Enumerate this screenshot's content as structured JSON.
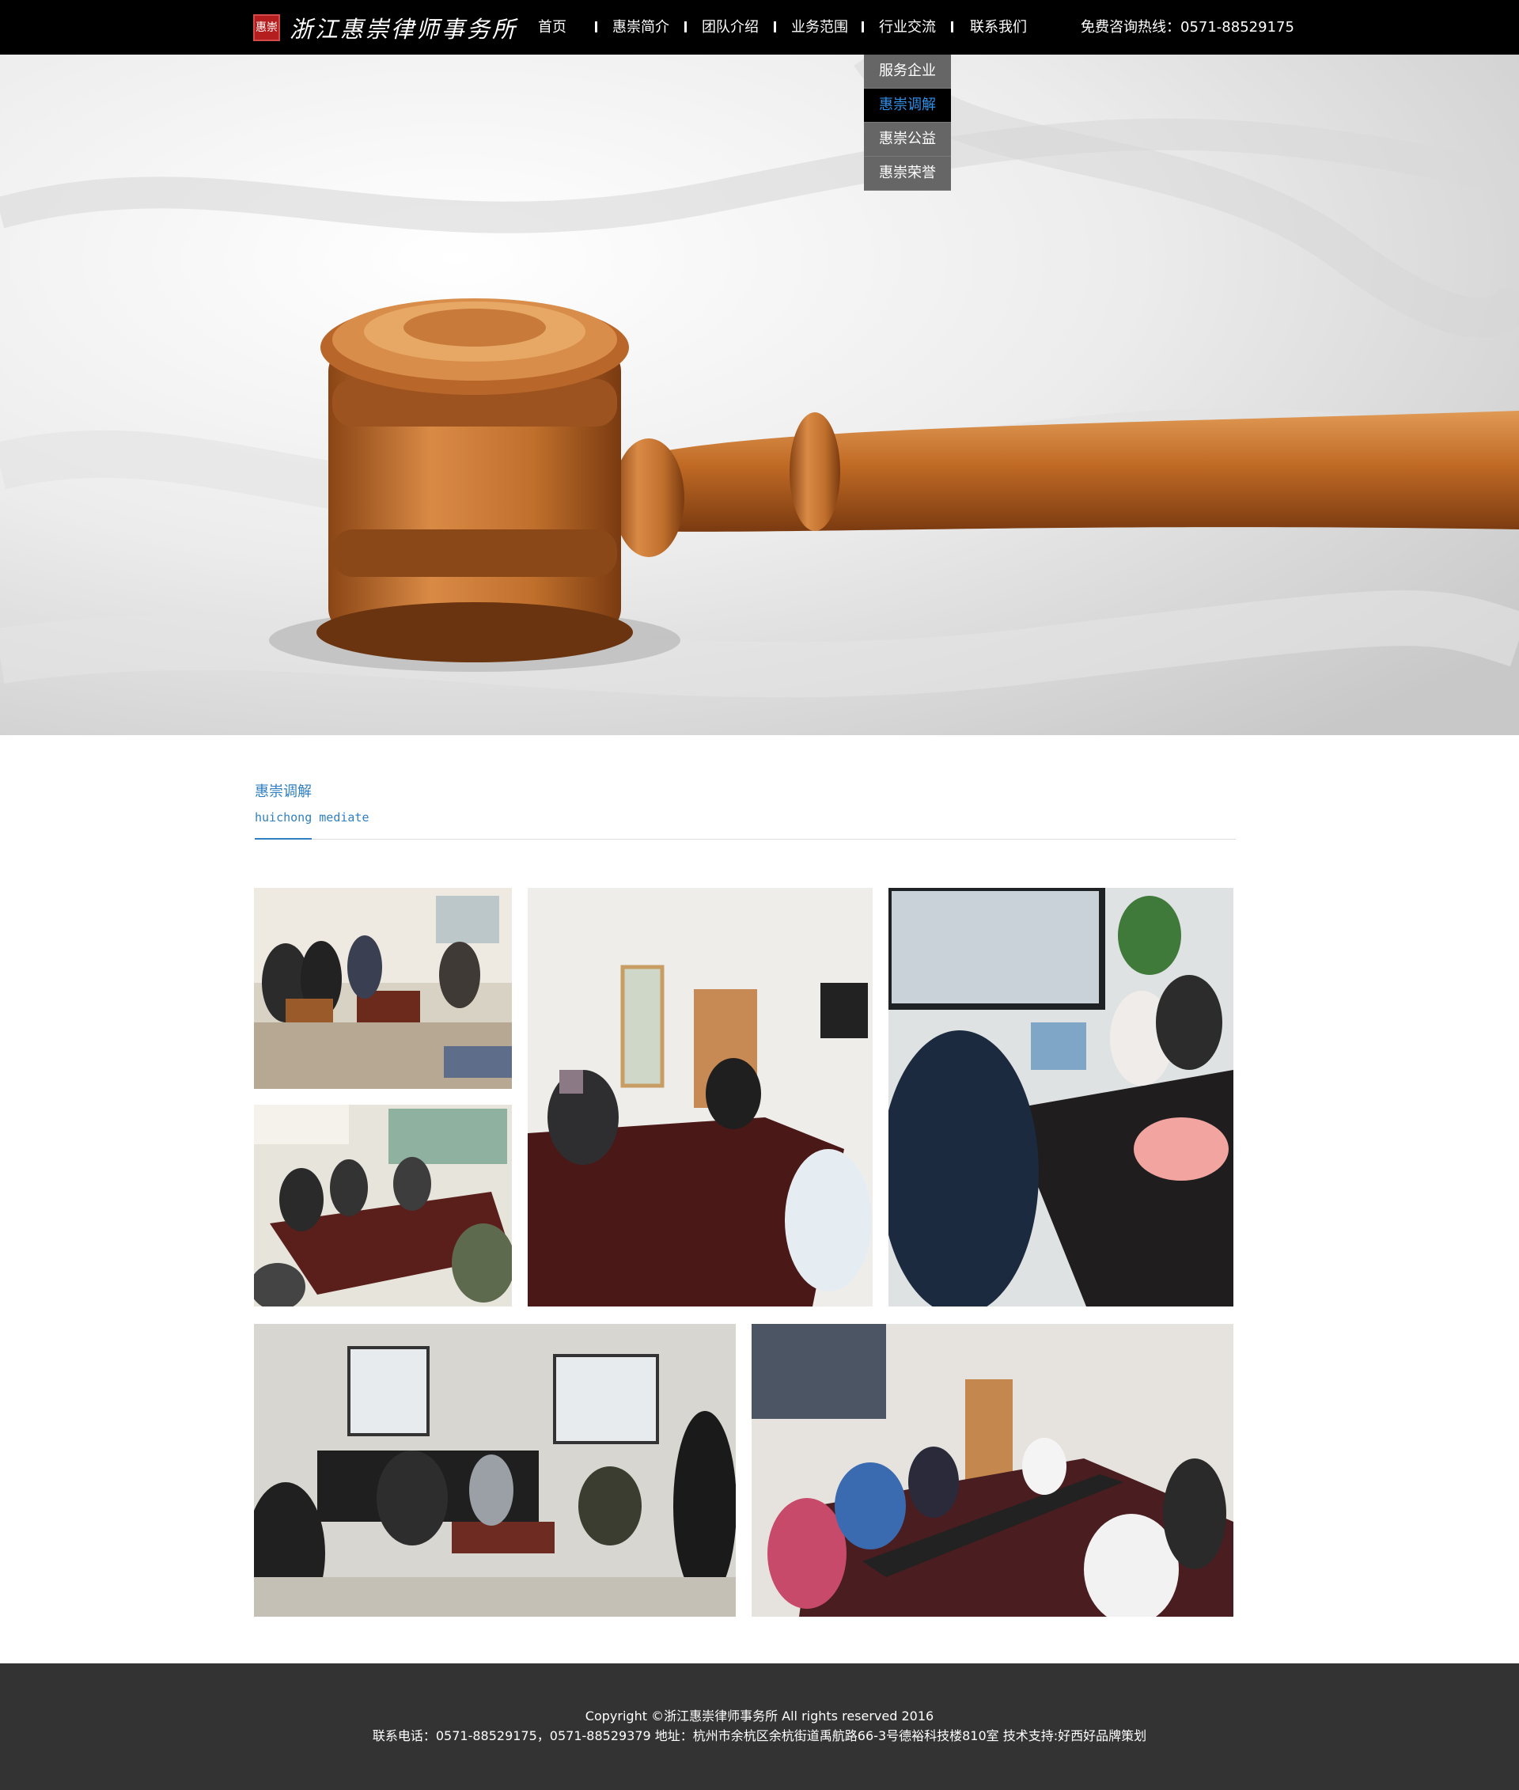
{
  "header": {
    "logo_seal": "惠崇",
    "logo_text": "浙江惠崇律师事务所",
    "hotline": "免费咨询热线：0571-88529175"
  },
  "nav": {
    "items": [
      {
        "label": "首页"
      },
      {
        "label": "惠崇简介"
      },
      {
        "label": "团队介绍"
      },
      {
        "label": "业务范围"
      },
      {
        "label": "行业交流"
      },
      {
        "label": "联系我们"
      }
    ],
    "dropdown": [
      {
        "label": "服务企业",
        "active": false
      },
      {
        "label": "惠崇调解",
        "active": true
      },
      {
        "label": "惠崇公益",
        "active": false
      },
      {
        "label": "惠崇荣誉",
        "active": false
      }
    ]
  },
  "hero": {
    "image": "wooden-gavel-on-white-cloth"
  },
  "section": {
    "title": "惠崇调解",
    "subtitle": "huichong mediate"
  },
  "gallery": {
    "photos": [
      {
        "subject": "mediation-meeting-sofas"
      },
      {
        "subject": "mediation-meeting-conference-table"
      },
      {
        "subject": "mediation-meeting-table-with-flowers"
      },
      {
        "subject": "mediation-meeting-office-round-table"
      },
      {
        "subject": "mediation-meeting-sofa-room"
      },
      {
        "subject": "mediation-meeting-long-table"
      }
    ]
  },
  "footer": {
    "copyright": "Copyright ©浙江惠崇律师事务所 All rights reserved 2016",
    "contact": "联系电话：0571-88529175，0571-88529379 地址：杭州市余杭区余杭街道禹航路66-3号德裕科技楼810室 技术支持:好西好品牌策划"
  },
  "colors": {
    "topbar": "#000000",
    "accent": "#2f7fc1",
    "dropdown_bg": "#666666",
    "footer_bg": "#333333"
  }
}
